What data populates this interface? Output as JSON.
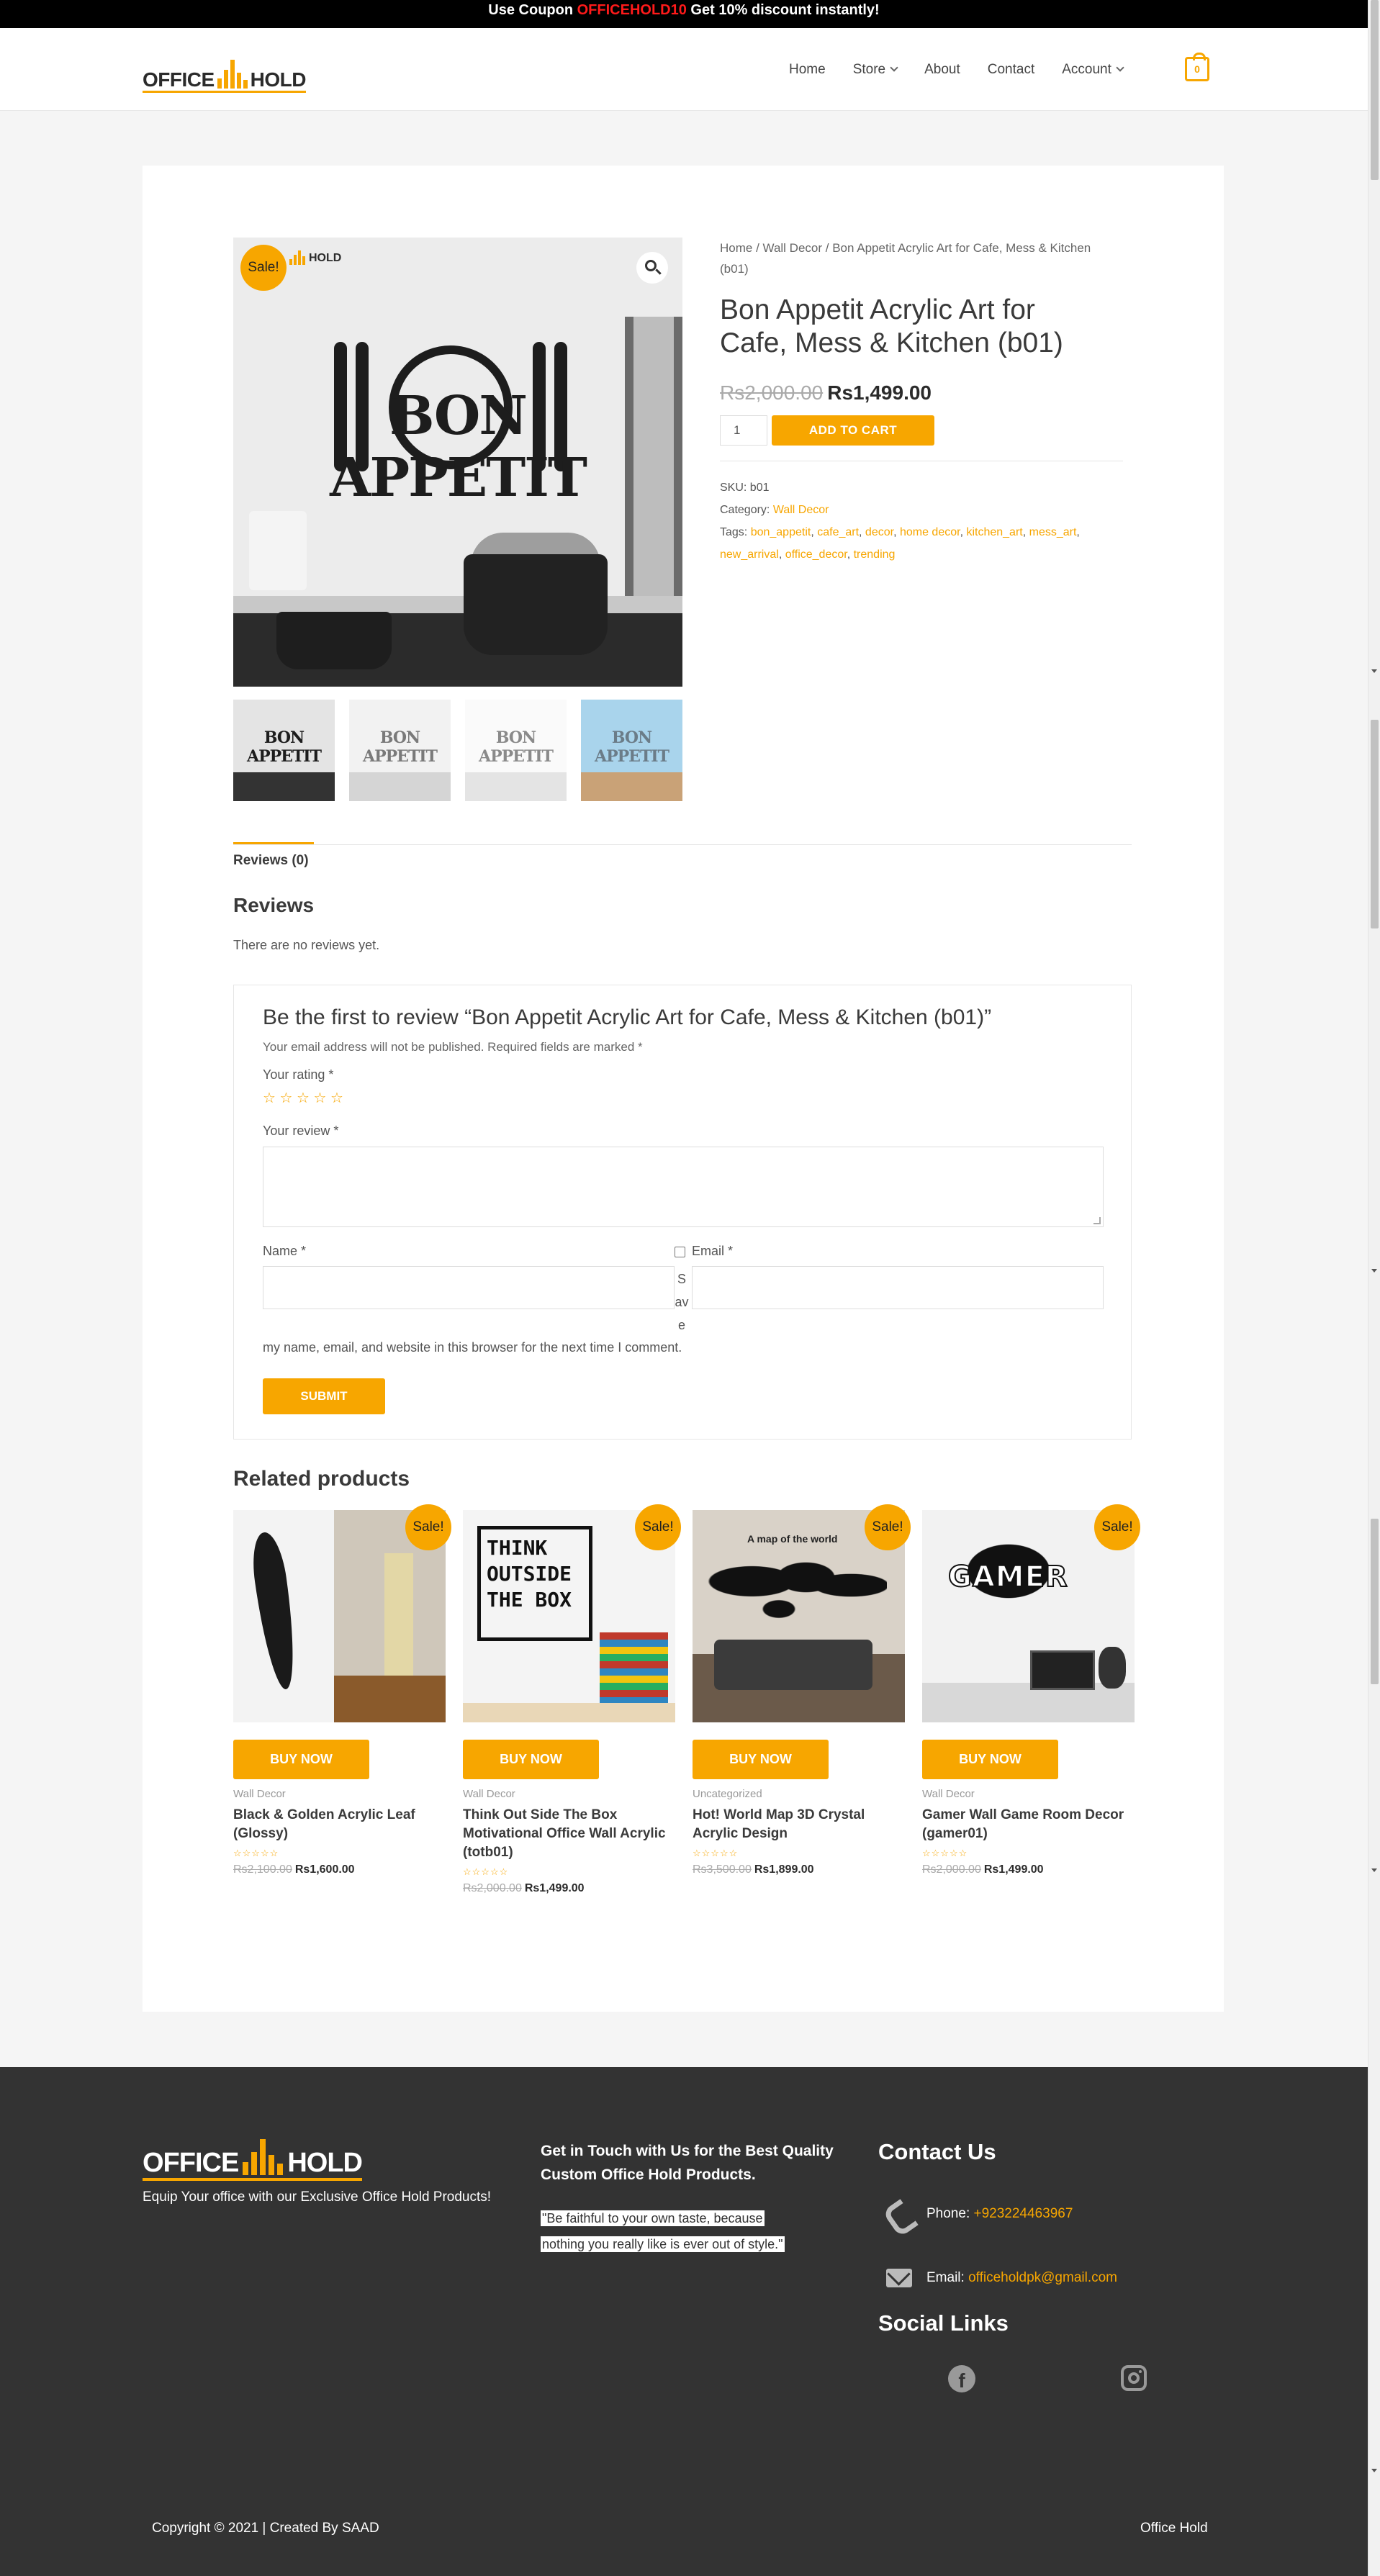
{
  "topbar": {
    "prefix": "Use Coupon ",
    "coupon": "OFFICEHOLD10",
    "suffix": " Get 10% discount instantly!"
  },
  "header": {
    "logo_left": "OFFICE",
    "logo_right": "HOLD",
    "nav": [
      {
        "label": "Home"
      },
      {
        "label": "Store"
      },
      {
        "label": "About"
      },
      {
        "label": "Contact"
      },
      {
        "label": "Account"
      }
    ],
    "cart_count": "0"
  },
  "product": {
    "sale_badge": "Sale!",
    "image_text": "BON APPETIT",
    "image_brand": "HOLD",
    "breadcrumb": {
      "home": "Home",
      "sep": " / ",
      "category": "Wall Decor",
      "current": "Bon Appetit Acrylic Art for Cafe, Mess & Kitchen (b01)"
    },
    "title": "Bon Appetit Acrylic Art for Cafe, Mess & Kitchen (b01)",
    "price_old": "Rs2,000.00",
    "price_new": "Rs1,499.00",
    "quantity": "1",
    "add_to_cart": "ADD TO CART",
    "sku_label": "SKU: ",
    "sku": "b01",
    "category_label": "Category: ",
    "category": "Wall Decor",
    "tags_label": "Tags: ",
    "tags": [
      "bon_appetit",
      "cafe_art",
      "decor",
      "home decor",
      "kitchen_art",
      "mess_art",
      "new_arrival",
      "office_decor",
      "trending"
    ],
    "thumb_text": "BON APPETIT"
  },
  "reviews": {
    "tab": "Reviews (0)",
    "heading": "Reviews",
    "empty": "There are no reviews yet.",
    "form_title": "Be the first to review “Bon Appetit Acrylic Art for Cafe, Mess & Kitchen (b01)”",
    "form_note": "Your email address will not be published. Required fields are marked *",
    "rating_label": "Your rating *",
    "stars": "☆ ☆ ☆ ☆ ☆",
    "review_label": "Your review *",
    "name_label": "Name *",
    "email_label": "Email *",
    "save_fragment_1": "S",
    "save_fragment_2": "av",
    "save_fragment_3": "e",
    "save_rest": "my name, email, and website in this browser for the next time I comment.",
    "submit": "SUBMIT"
  },
  "related": {
    "heading": "Related products",
    "items": [
      {
        "sale": "Sale!",
        "buy": "BUY NOW",
        "category": "Wall Decor",
        "name": "Black & Golden Acrylic Leaf (Glossy)",
        "rating": "☆☆☆☆☆",
        "old": "Rs2,100.00",
        "new": "Rs1,600.00"
      },
      {
        "sale": "Sale!",
        "buy": "BUY NOW",
        "category": "Wall Decor",
        "name": "Think Out Side The Box Motivational Office Wall Acrylic (totb01)",
        "rating": "☆☆☆☆☆",
        "old": "Rs2,000.00",
        "new": "Rs1,499.00",
        "img_text": "THINK OUTSIDE THE BOX"
      },
      {
        "sale": "Sale!",
        "buy": "BUY NOW",
        "category": "Uncategorized",
        "name": "Hot! World Map 3D Crystal Acrylic Design",
        "rating": "☆☆☆☆☆",
        "old": "Rs3,500.00",
        "new": "Rs1,899.00",
        "img_text": "A map of the world"
      },
      {
        "sale": "Sale!",
        "buy": "BUY NOW",
        "category": "Wall Decor",
        "name": "Gamer Wall Game Room Decor (gamer01)",
        "rating": "☆☆☆☆☆",
        "old": "Rs2,000.00",
        "new": "Rs1,499.00",
        "img_text": "GAMER"
      }
    ]
  },
  "footer": {
    "logo_left": "OFFICE",
    "logo_right": "HOLD",
    "tagline": "Equip Your office with our Exclusive Office Hold Products!",
    "mid_heading": "Get in Touch with Us for the Best Quality Custom Office Hold Products.",
    "quote_1": "\"Be faithful to your own taste, because",
    "quote_2": "nothing you really like is ever out of style.\"",
    "contact_heading": "Contact Us",
    "phone_label": "Phone: ",
    "phone": "+923224463967",
    "email_label": "Email: ",
    "email": "officeholdpk@gmail.com",
    "social_heading": "Social Links",
    "copyright": "Copyright © 2021 | Created By SAAD",
    "brand": "Office Hold"
  },
  "colors": {
    "accent": "#f7a600",
    "topbar_bg": "#000000",
    "coupon": "#ff1a1a",
    "footer_bg": "#333333"
  },
  "icons": [
    "search-icon",
    "cart-icon",
    "chevron-down-icon",
    "phone-icon",
    "mail-icon",
    "facebook-icon",
    "instagram-icon"
  ]
}
